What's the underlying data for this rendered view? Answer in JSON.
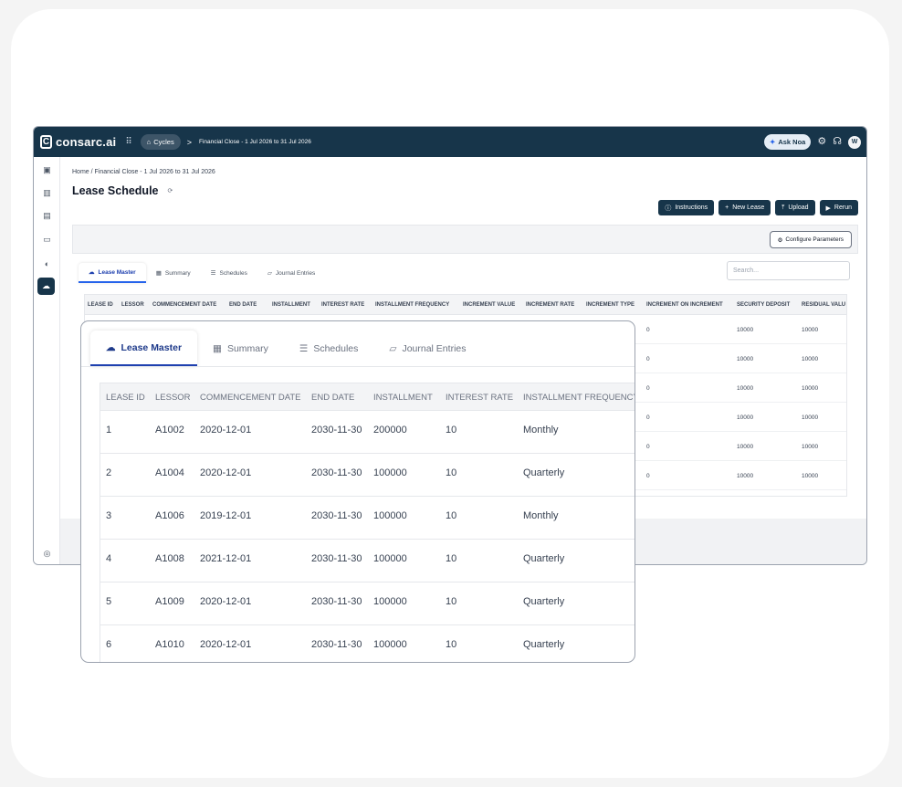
{
  "app": {
    "logo_letter": "C",
    "logo_text": "consarc.ai",
    "cycles_label": "Cycles",
    "breadcrumb_sep": ">",
    "breadcrumb_top": "Financial Close - 1 Jul 2026 to 31 Jul 2026",
    "ask_label": "Ask Noa",
    "avatar_initial": "W"
  },
  "page": {
    "breadcrumb": "Home  /  Financial Close - 1 Jul 2026 to 31 Jul 2026",
    "title": "Lease Schedule",
    "buttons": [
      "Instructions",
      "New Lease",
      "Upload",
      "Rerun"
    ],
    "configure_label": "Configure Parameters",
    "search_placeholder": "Search..."
  },
  "tabs": [
    "Lease Master",
    "Summary",
    "Schedules",
    "Journal Entries"
  ],
  "bg_table": {
    "headers": [
      "LEASE ID",
      "LESSOR",
      "COMMENCEMENT DATE",
      "END DATE",
      "INSTALLMENT",
      "INTEREST RATE",
      "INSTALLMENT FREQUENCY",
      "INCREMENT VALUE",
      "INCREMENT RATE",
      "INCREMENT TYPE",
      "INCREMENT ON INCREMENT",
      "SECURITY DEPOSIT",
      "RESIDUAL VALU"
    ],
    "rows": [
      [
        "0",
        "10000",
        "10000"
      ],
      [
        "0",
        "10000",
        "10000"
      ],
      [
        "0",
        "10000",
        "10000"
      ],
      [
        "0",
        "10000",
        "10000"
      ],
      [
        "0",
        "10000",
        "10000"
      ],
      [
        "0",
        "10000",
        "10000"
      ]
    ]
  },
  "zoom_table": {
    "headers": [
      "LEASE ID",
      "LESSOR",
      "COMMENCEMENT DATE",
      "END DATE",
      "INSTALLMENT",
      "INTEREST RATE",
      "INSTALLMENT FREQUENCY"
    ],
    "rows": [
      [
        "1",
        "A1002",
        "2020-12-01",
        "2030-11-30",
        "200000",
        "10",
        "Monthly"
      ],
      [
        "2",
        "A1004",
        "2020-12-01",
        "2030-11-30",
        "100000",
        "10",
        "Quarterly"
      ],
      [
        "3",
        "A1006",
        "2019-12-01",
        "2030-11-30",
        "100000",
        "10",
        "Monthly"
      ],
      [
        "4",
        "A1008",
        "2021-12-01",
        "2030-11-30",
        "100000",
        "10",
        "Quarterly"
      ],
      [
        "5",
        "A1009",
        "2020-12-01",
        "2030-11-30",
        "100000",
        "10",
        "Quarterly"
      ],
      [
        "6",
        "A1010",
        "2020-12-01",
        "2030-11-30",
        "100000",
        "10",
        "Quarterly"
      ]
    ]
  },
  "colors": {
    "navbar": "#17354a",
    "accent": "#1e40af"
  }
}
